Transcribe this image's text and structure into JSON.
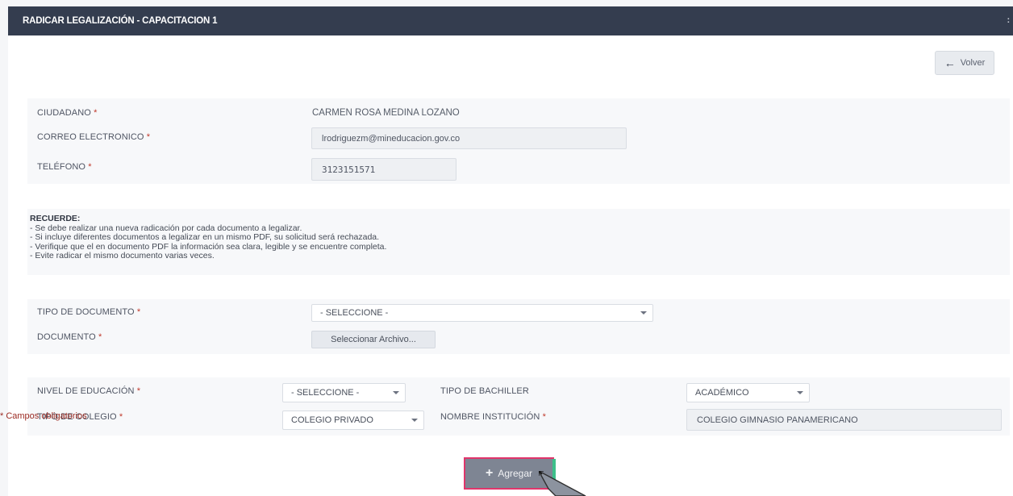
{
  "header": {
    "title": "RADICAR LEGALIZACIÓN - CAPACITACION 1",
    "right_glyph": ":"
  },
  "back_button": {
    "label": "Volver"
  },
  "applicant": {
    "citizen_label": "CIUDADANO",
    "citizen_value": "CARMEN ROSA MEDINA LOZANO",
    "email_label": "CORREO ELECTRONICO",
    "email_value": "lrodriguezm@mineducacion.gov.co",
    "phone_label": "TELÉFONO",
    "phone_value": "3123151571",
    "required_mark": "*"
  },
  "notice": {
    "title": "RECUERDE:",
    "lines": [
      "- Se debe realizar una nueva radicación por cada documento a legalizar.",
      "- Si incluye diferentes documentos a legalizar en un mismo PDF, su solicitud será rechazada.",
      "- Verifique que el en documento PDF la información sea clara, legible y se encuentre completa.",
      "- Evite radicar el mismo documento varias veces."
    ]
  },
  "document": {
    "type_label": "TIPO DE DOCUMENTO",
    "type_selected": "- SELECCIONE -",
    "file_label": "DOCUMENTO",
    "file_button": "Seleccionar Archivo..."
  },
  "education": {
    "level_label": "NIVEL DE EDUCACIÓN",
    "level_selected": "- SELECCIONE -",
    "bachiller_label": "TIPO DE BACHILLER",
    "bachiller_selected": "ACADÉMICO",
    "school_type_label": "TIPO DE COLEGIO",
    "school_type_selected": "COLEGIO PRIVADO",
    "institution_label": "NOMBRE INSTITUCIÓN",
    "institution_value": "COLEGIO GIMNASIO PANAMERICANO"
  },
  "footnote": "* Campos obligatorios",
  "add_button": {
    "label": "Agregar"
  },
  "colors": {
    "header_bg": "#343d4f",
    "required": "#c0392b",
    "add_button_bg": "#7e8593",
    "add_button_border": "#e0356b"
  }
}
